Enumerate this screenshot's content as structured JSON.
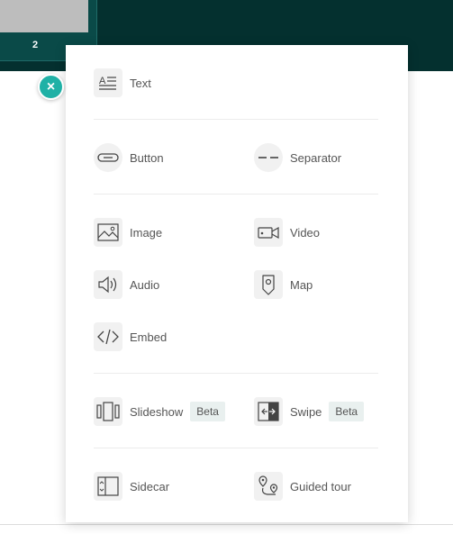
{
  "background": {
    "slide_number": "2"
  },
  "close_button": {
    "glyph": "×",
    "accent": "#1fb1a6"
  },
  "menu": {
    "text": {
      "label": "Text",
      "icon": "text-block-icon"
    },
    "button": {
      "label": "Button",
      "icon": "button-pill-icon"
    },
    "separator": {
      "label": "Separator",
      "icon": "dashed-line-icon"
    },
    "image": {
      "label": "Image",
      "icon": "image-icon"
    },
    "video": {
      "label": "Video",
      "icon": "video-camera-icon"
    },
    "audio": {
      "label": "Audio",
      "icon": "speaker-icon"
    },
    "map": {
      "label": "Map",
      "icon": "map-pin-icon"
    },
    "embed": {
      "label": "Embed",
      "icon": "code-icon"
    },
    "slideshow": {
      "label": "Slideshow",
      "badge": "Beta",
      "icon": "slideshow-icon"
    },
    "swipe": {
      "label": "Swipe",
      "badge": "Beta",
      "icon": "swipe-icon"
    },
    "sidecar": {
      "label": "Sidecar",
      "icon": "sidecar-icon"
    },
    "guided_tour": {
      "label": "Guided tour",
      "icon": "guided-tour-icon"
    }
  },
  "colors": {
    "header_bg": "#04302f",
    "icon_bg": "#f1f1f1",
    "label": "#555555",
    "badge_bg": "#e9f0ef"
  }
}
